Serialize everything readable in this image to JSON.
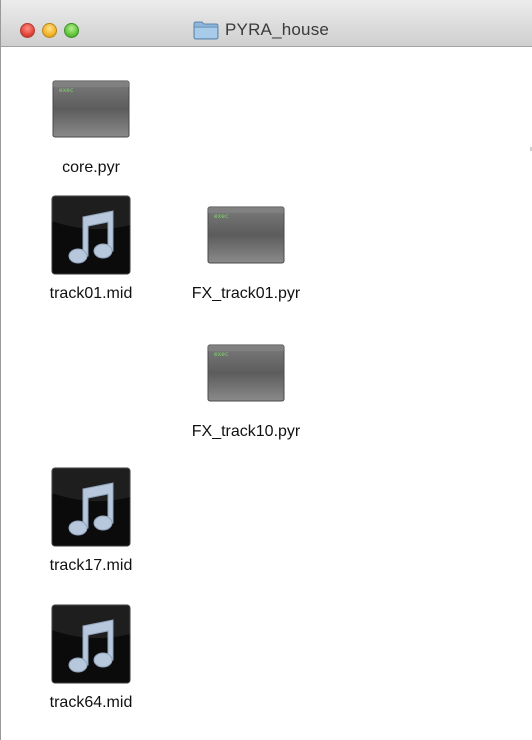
{
  "window": {
    "title": "PYRA_house",
    "controls": [
      "close",
      "minimize",
      "zoom"
    ]
  },
  "items": [
    {
      "name": "core.pyr",
      "icon": "exec-file-icon"
    },
    {
      "name": "track01.mid",
      "icon": "music-note-icon"
    },
    {
      "name": "FX_track01.pyr",
      "icon": "exec-file-icon"
    },
    {
      "name": "FX_track10.pyr",
      "icon": "exec-file-icon"
    },
    {
      "name": "track17.mid",
      "icon": "music-note-icon"
    },
    {
      "name": "track64.mid",
      "icon": "music-note-icon"
    }
  ],
  "exec_badge": "exec",
  "colors": {
    "exec_text": "#7fd36b",
    "music_bg": "#0b0b0b",
    "note": "#b7c8dc"
  }
}
